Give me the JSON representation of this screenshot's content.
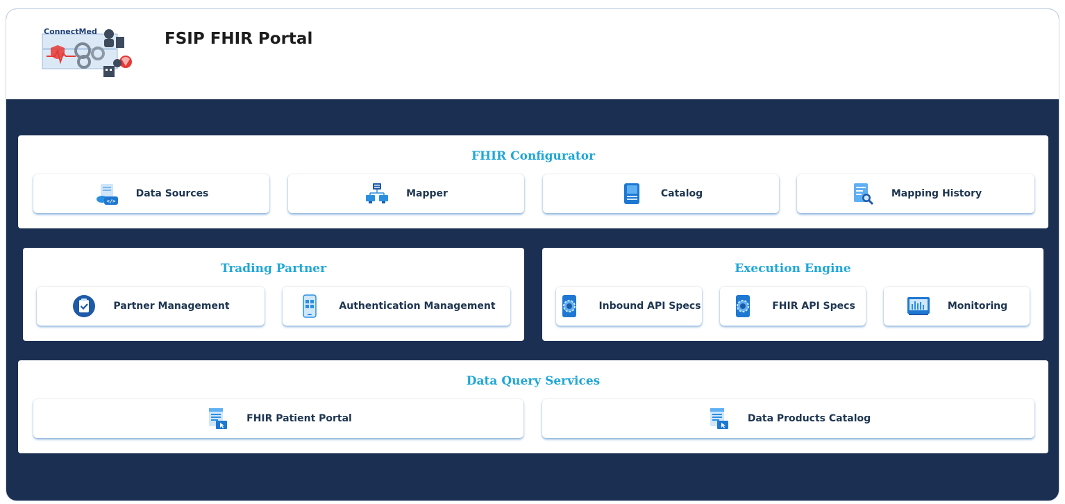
{
  "header": {
    "app_title": "FSIP FHIR Portal",
    "logo_text": "ConnectMed"
  },
  "sections": {
    "fhir_configurator": {
      "title": "FHIR Configurator",
      "items": [
        {
          "label": "Data Sources",
          "icon": "data-sources-icon"
        },
        {
          "label": "Mapper",
          "icon": "mapper-network-icon"
        },
        {
          "label": "Catalog",
          "icon": "catalog-book-icon"
        },
        {
          "label": "Mapping History",
          "icon": "mapping-history-icon"
        }
      ]
    },
    "trading_partner": {
      "title": "Trading Partner",
      "items": [
        {
          "label": "Partner Management",
          "icon": "clipboard-check-icon"
        },
        {
          "label": "Authentication Management",
          "icon": "mobile-app-icon"
        }
      ]
    },
    "execution_engine": {
      "title": "Execution Engine",
      "items": [
        {
          "label": "Inbound API Specs",
          "icon": "api-gear-icon"
        },
        {
          "label": "FHIR API Specs",
          "icon": "api-gear-icon"
        },
        {
          "label": "Monitoring",
          "icon": "monitor-chart-icon"
        }
      ]
    },
    "data_query_services": {
      "title": "Data Query Services",
      "items": [
        {
          "label": "FHIR Patient Portal",
          "icon": "document-pointer-icon"
        },
        {
          "label": "Data Products Catalog",
          "icon": "document-pointer-icon"
        }
      ]
    }
  },
  "colors": {
    "background": "#1b2f52",
    "section_title": "#20a7d8",
    "card_text": "#1d3550",
    "icon_blue": "#2b8fe0",
    "icon_dark": "#1e5aa8"
  }
}
